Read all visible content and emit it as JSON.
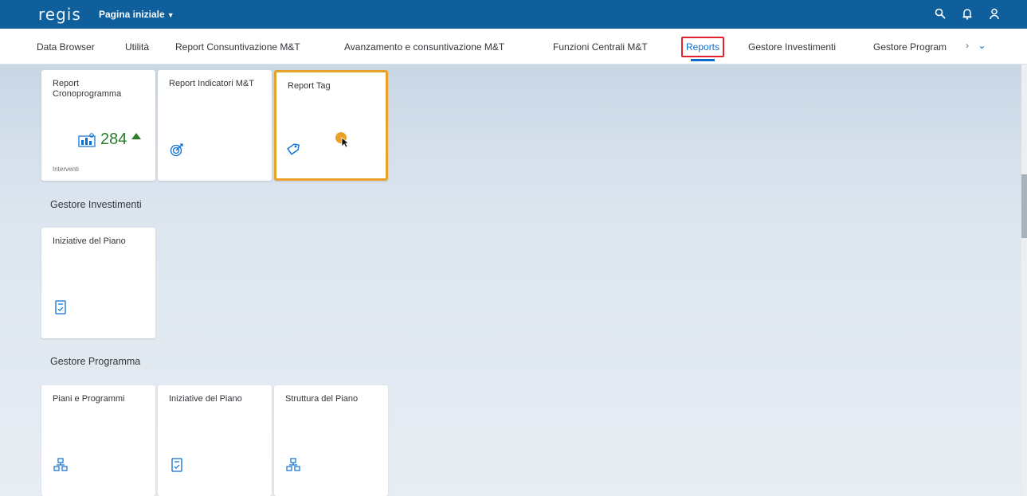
{
  "shell": {
    "logo": "regis",
    "page_menu": "Pagina iniziale",
    "actions": [
      "search-icon",
      "bell-icon",
      "user-icon"
    ],
    "color": "#0f5f9c"
  },
  "tabs": [
    {
      "label": "Data Browser"
    },
    {
      "label": "Utilità"
    },
    {
      "label": "Report Consuntivazione M&T"
    },
    {
      "label": "Avanzamento e consuntivazione M&T"
    },
    {
      "label": "Funzioni Centrali M&T"
    },
    {
      "label": "Reports",
      "active": true
    },
    {
      "label": "Gestore Investimenti"
    },
    {
      "label": "Gestore Program"
    }
  ],
  "tab_overflow": {
    "more": "›",
    "expand": "⌄"
  },
  "groups": {
    "reports": {
      "tiles": [
        {
          "title": "Report Cronoprogramma",
          "kpi": "284",
          "footer": "Interventi",
          "icon": "chart-icon"
        },
        {
          "title": "Report Indicatori M&T",
          "icon": "target-icon"
        },
        {
          "title": "Report Tag",
          "icon": "tag-icon",
          "selected": true
        }
      ]
    },
    "gestore_investimenti": {
      "title": "Gestore Investimenti",
      "tiles": [
        {
          "title": "Iniziative del Piano",
          "icon": "document-check-icon"
        }
      ]
    },
    "gestore_programma": {
      "title": "Gestore Programma",
      "tiles": [
        {
          "title": "Piani e Programmi",
          "icon": "hierarchy-icon"
        },
        {
          "title": "Iniziative del Piano",
          "icon": "document-check-icon"
        },
        {
          "title": "Struttura del Piano",
          "icon": "hierarchy-icon"
        }
      ]
    }
  },
  "colors": {
    "accent": "#0a6ed1",
    "selected": "#e9a229",
    "kpi": "#2b7c2b",
    "highlight": "#e0232e"
  }
}
